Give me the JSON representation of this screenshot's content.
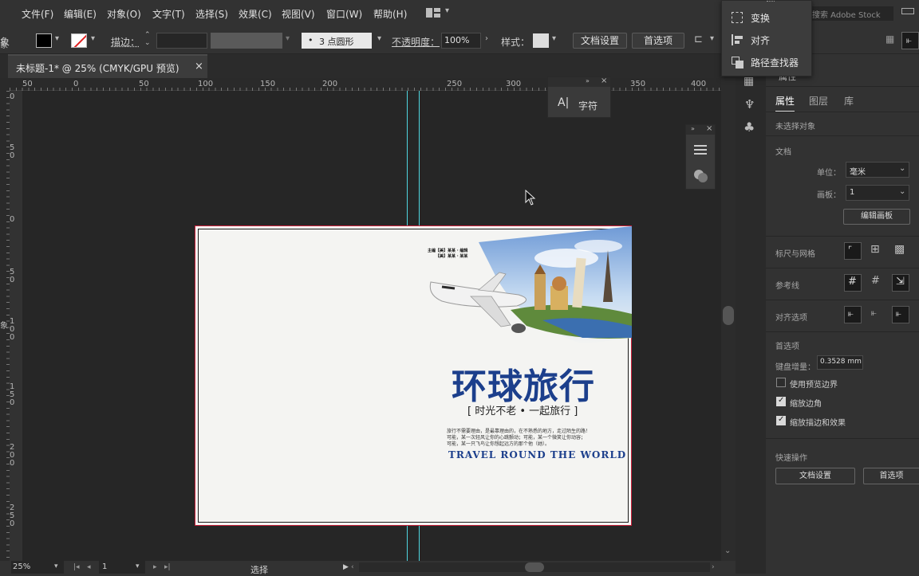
{
  "menu": [
    "文件(F)",
    "编辑(E)",
    "对象(O)",
    "文字(T)",
    "选择(S)",
    "效果(C)",
    "视图(V)",
    "窗口(W)",
    "帮助(H)"
  ],
  "search_placeholder": "搜索 Adobe Stock",
  "control_bar": {
    "left_label": "象",
    "stroke_label": "描边：",
    "brush_label": "3 点圆形",
    "opacity_label": "不透明度：",
    "opacity_value": "100%",
    "style_label": "样式：",
    "doc_settings": "文档设置",
    "preferences": "首选项"
  },
  "tab": {
    "title": "未标题-1* @ 25% (CMYK/GPU 预览)",
    "close": "×"
  },
  "ruler_h": [
    "50",
    "0",
    "50",
    "100",
    "150",
    "200",
    "250",
    "300",
    "350",
    "400"
  ],
  "ruler_v_marks": [
    {
      "digits": [
        "0"
      ]
    },
    {
      "digits": [
        "5",
        "0"
      ]
    },
    {
      "digits": [
        "0"
      ]
    },
    {
      "digits": [
        "5",
        "0"
      ]
    },
    {
      "digits": [
        "1",
        "0",
        "0"
      ]
    },
    {
      "digits": [
        "1",
        "5",
        "0"
      ]
    },
    {
      "digits": [
        "2",
        "0",
        "0"
      ]
    },
    {
      "digits": [
        "2",
        "5",
        "0"
      ]
    }
  ],
  "ruler_v_edge": [
    "象",
    "象"
  ],
  "flyout": {
    "items": [
      "变换",
      "对齐",
      "路径查找器"
    ]
  },
  "char_panel": {
    "label": "字符"
  },
  "properties": {
    "partial_title": "属性",
    "tabs": [
      "属性",
      "图层",
      "库"
    ],
    "no_selection": "未选择对象",
    "document_heading": "文档",
    "unit_label": "单位：",
    "unit_value": "毫米",
    "artboard_label": "画板：",
    "artboard_value": "1",
    "edit_artboard": "编辑画板",
    "rulers_grids": "标尺与网格",
    "guides": "参考线",
    "snap_options": "对齐选项",
    "prefs_heading": "首选项",
    "keyboard_increment_label": "键盘增量：",
    "keyboard_increment_value": "0.3528 mm",
    "use_preview_bounds": "使用预览边界",
    "scale_corners": "缩放边角",
    "scale_strokes": "缩放描边和效果",
    "quick_actions": "快速操作",
    "qa_doc_settings": "文档设置",
    "qa_preferences": "首选项"
  },
  "cover": {
    "title": "环球旅行",
    "subtitle": "[ 时光不老 • 一起旅行 ]",
    "body": [
      "旅行不需要理由，是最靠理由的，在不熟悉的地方，走过陌生的路！",
      "可能，某一次轻风让你的心跳颤动；可能，某一个微笑让你动容；",
      "可能，某一只飞鸟让你想起远方的那个他（她）。"
    ],
    "english": "TRAVEL ROUND THE WORLD",
    "tags": [
      "主编【美】某某 · 编辑",
      "【美】某某 · 某某"
    ]
  },
  "status": {
    "zoom": "25%",
    "artboard": "1",
    "tool": "选择"
  },
  "colors": {
    "accent_blue": "#1c3f8c",
    "artboard_border": "#c9203a",
    "guide_cyan": "#4fd6e0"
  }
}
